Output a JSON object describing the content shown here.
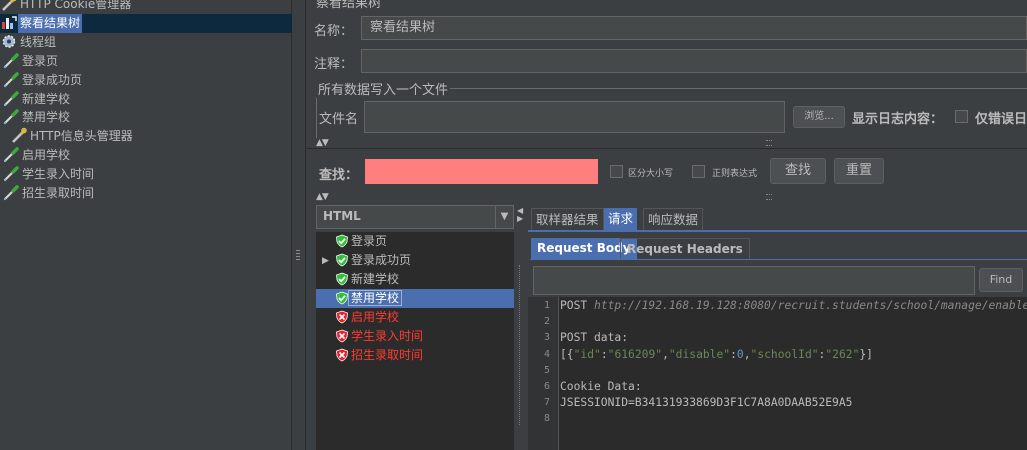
{
  "left_tree": {
    "items": [
      {
        "label": "HTTP Cookie管理器",
        "icon": "wrench-icon",
        "indent": 0,
        "selected": false
      },
      {
        "label": "察看结果树",
        "icon": "chart-icon",
        "indent": 0,
        "selected": true
      },
      {
        "label": "线程组",
        "icon": "gear-icon",
        "indent": 0,
        "selected": false
      },
      {
        "label": "登录页",
        "icon": "pipette-icon",
        "indent": 1,
        "selected": false
      },
      {
        "label": "登录成功页",
        "icon": "pipette-icon",
        "indent": 1,
        "selected": false
      },
      {
        "label": "新建学校",
        "icon": "pipette-icon",
        "indent": 1,
        "selected": false
      },
      {
        "label": "禁用学校",
        "icon": "pipette-icon",
        "indent": 1,
        "selected": false
      },
      {
        "label": "HTTP信息头管理器",
        "icon": "wrench-icon",
        "indent": 2,
        "selected": false
      },
      {
        "label": "启用学校",
        "icon": "pipette-icon",
        "indent": 1,
        "selected": false
      },
      {
        "label": "学生录入时间",
        "icon": "pipette-icon",
        "indent": 1,
        "selected": false
      },
      {
        "label": "招生录取时间",
        "icon": "pipette-icon",
        "indent": 1,
        "selected": false
      }
    ]
  },
  "panel": {
    "title": "察看结果树",
    "name_label": "名称：",
    "name_value": "察看结果树",
    "comment_label": "注释：",
    "comment_value": "",
    "fileset_title": "所有数据写入一个文件",
    "filename_label": "文件名",
    "filename_value": "",
    "browse_label": "浏览...",
    "log_label": "显示日志内容：",
    "errors_only_label": "仅错误日"
  },
  "search": {
    "label": "查找：",
    "value": "",
    "case_label": "区分大小写",
    "regex_label": "正则表达式",
    "find_button": "查找",
    "reset_button": "重置",
    "field_color": "#ff7f7f"
  },
  "results": {
    "renderer": "HTML",
    "items": [
      {
        "label": "登录页",
        "status": "ok",
        "expandable": false,
        "selected": false
      },
      {
        "label": "登录成功页",
        "status": "ok",
        "expandable": true,
        "selected": false
      },
      {
        "label": "新建学校",
        "status": "ok",
        "expandable": false,
        "selected": false
      },
      {
        "label": "禁用学校",
        "status": "ok",
        "expandable": false,
        "selected": true
      },
      {
        "label": "启用学校",
        "status": "error",
        "expandable": false,
        "selected": false
      },
      {
        "label": "学生录入时间",
        "status": "error",
        "expandable": false,
        "selected": false
      },
      {
        "label": "招生录取时间",
        "status": "error",
        "expandable": false,
        "selected": false
      }
    ]
  },
  "tabs": [
    {
      "label": "取样器结果",
      "active": false
    },
    {
      "label": "请求",
      "active": true
    },
    {
      "label": "响应数据",
      "active": false
    }
  ],
  "subtabs": [
    {
      "label": "Request Body",
      "active": true
    },
    {
      "label": "Request Headers",
      "active": false
    }
  ],
  "find": {
    "value": "",
    "button": "Find"
  },
  "code": {
    "lines": [
      {
        "n": "1",
        "text": "POST http://192.168.19.128:8080/recruit.students/school/manage/enable"
      },
      {
        "n": "2",
        "text": ""
      },
      {
        "n": "3",
        "text": "POST data:"
      },
      {
        "n": "4",
        "text": "[{\"id\":\"616209\",\"disable\":0,\"schoolId\":\"262\"}]"
      },
      {
        "n": "5",
        "text": ""
      },
      {
        "n": "6",
        "text": "Cookie Data:"
      },
      {
        "n": "7",
        "text": "JSESSIONID=B34131933869D3F1C7A8A0DAAB52E9A5"
      },
      {
        "n": "8",
        "text": ""
      }
    ]
  },
  "colors": {
    "ok": "#2fbf3a",
    "error": "#e8202a",
    "selection": "#4b6eaf"
  }
}
